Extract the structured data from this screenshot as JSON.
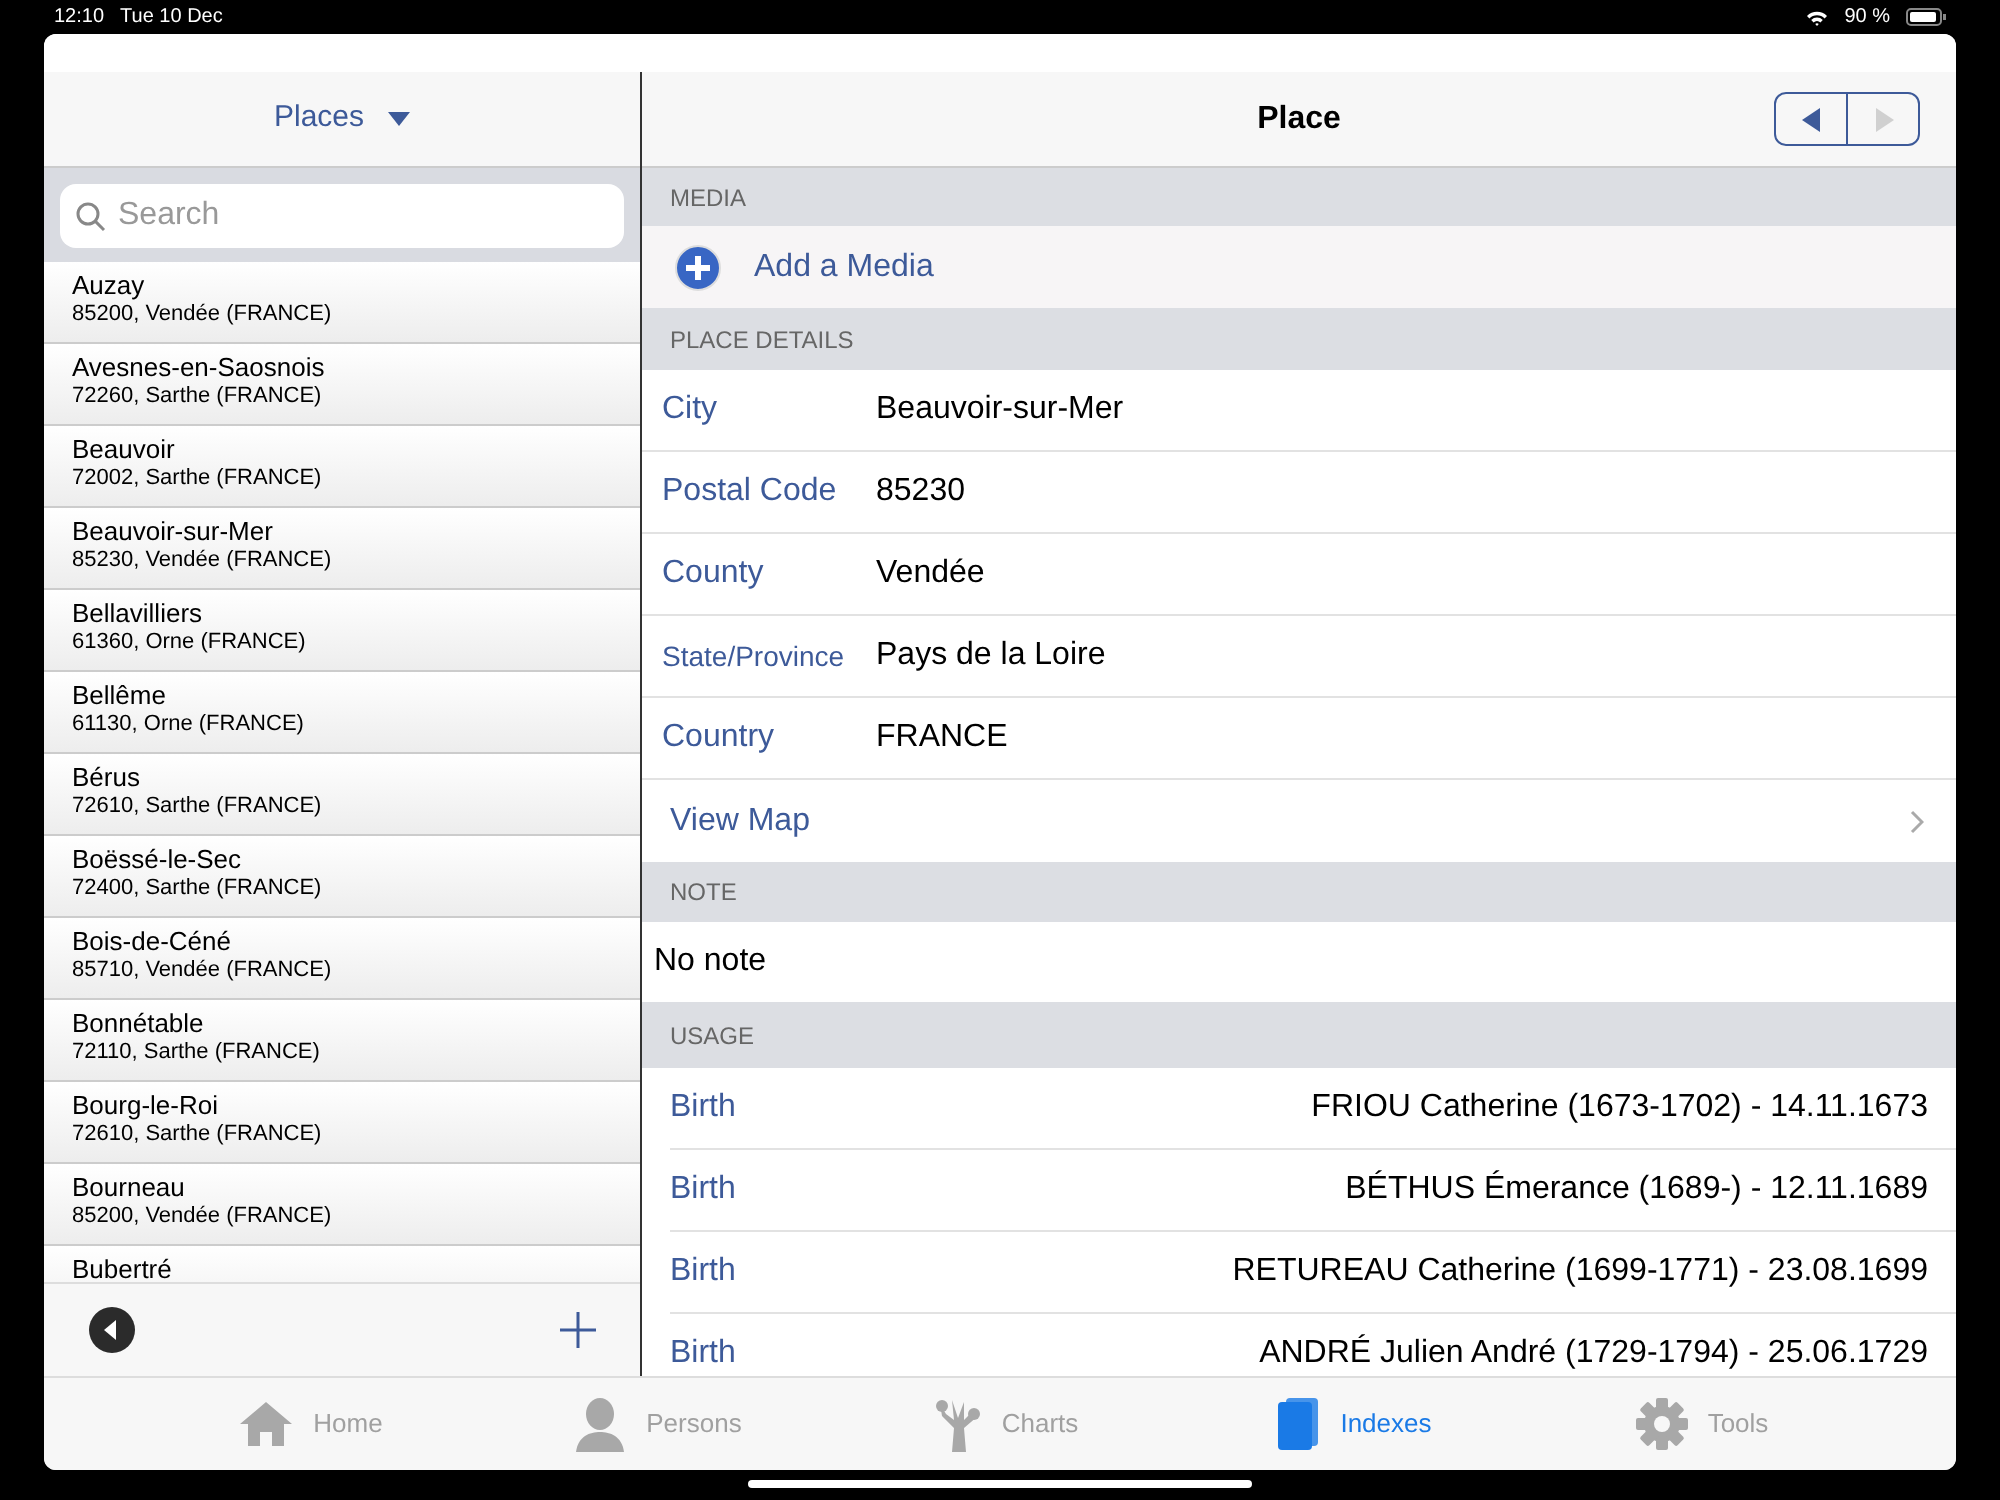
{
  "status_bar": {
    "time": "12:10",
    "date": "Tue 10 Dec",
    "battery": "90 %"
  },
  "list_header": {
    "title": "Places"
  },
  "search": {
    "placeholder": "Search"
  },
  "places": [
    {
      "name": "Auzay",
      "detail": "85200, Vendée (FRANCE)"
    },
    {
      "name": "Avesnes-en-Saosnois",
      "detail": "72260, Sarthe (FRANCE)"
    },
    {
      "name": "Beauvoir",
      "detail": "72002, Sarthe (FRANCE)"
    },
    {
      "name": "Beauvoir-sur-Mer",
      "detail": "85230, Vendée (FRANCE)"
    },
    {
      "name": "Bellavilliers",
      "detail": "61360, Orne (FRANCE)"
    },
    {
      "name": "Bellême",
      "detail": "61130, Orne (FRANCE)"
    },
    {
      "name": "Bérus",
      "detail": "72610, Sarthe (FRANCE)"
    },
    {
      "name": "Boëssé-le-Sec",
      "detail": "72400, Sarthe (FRANCE)"
    },
    {
      "name": "Bois-de-Céné",
      "detail": "85710, Vendée (FRANCE)"
    },
    {
      "name": "Bonnétable",
      "detail": "72110, Sarthe (FRANCE)"
    },
    {
      "name": "Bourg-le-Roi",
      "detail": "72610, Sarthe (FRANCE)"
    },
    {
      "name": "Bourneau",
      "detail": "85200, Vendée (FRANCE)"
    },
    {
      "name": "Bubertré"
    }
  ],
  "detail": {
    "title": "Place",
    "prev": {
      "disabled": false
    },
    "next": {
      "disabled": true
    }
  },
  "media": {
    "header": "MEDIA",
    "action": "Add a Media"
  },
  "place_details": {
    "header": "PLACE DETAILS",
    "fields": [
      {
        "label": "City",
        "value": "Beauvoir-sur-Mer"
      },
      {
        "label": "Postal Code",
        "value": "85230"
      },
      {
        "label": "County",
        "value": "Vendée"
      },
      {
        "label": "State/Province",
        "value": "Pays de la Loire"
      },
      {
        "label": "Country",
        "value": "FRANCE"
      }
    ],
    "map_link": "View Map"
  },
  "note": {
    "header": "NOTE",
    "text": "No note"
  },
  "usage": {
    "header": "USAGE",
    "rows": [
      {
        "event": "Birth",
        "person": "FRIOU Catherine (1673-1702) - 14.11.1673"
      },
      {
        "event": "Birth",
        "person": "BÉTHUS Émerance (1689-) - 12.11.1689"
      },
      {
        "event": "Birth",
        "person": "RETUREAU Catherine (1699-1771) - 23.08.1699"
      },
      {
        "event": "Birth",
        "person": "ANDRÉ Julien André (1729-1794) - 25.06.1729"
      }
    ]
  },
  "tab_bar": [
    {
      "label": "Home",
      "kind": "home",
      "selected": false
    },
    {
      "label": "Persons",
      "kind": "person",
      "selected": false
    },
    {
      "label": "Charts",
      "kind": "tree",
      "selected": false
    },
    {
      "label": "Indexes",
      "kind": "book",
      "selected": true
    },
    {
      "label": "Tools",
      "kind": "gear",
      "selected": false
    }
  ]
}
